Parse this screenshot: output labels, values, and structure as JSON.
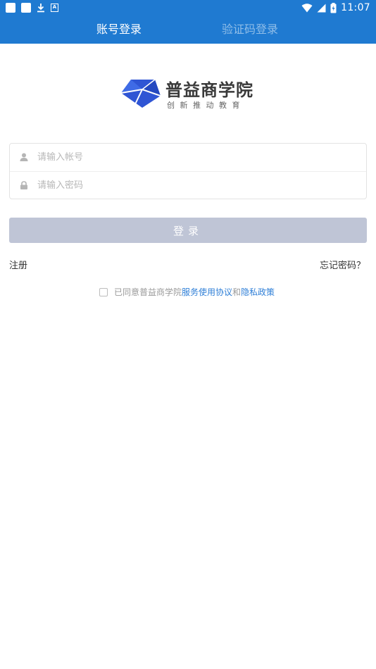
{
  "status_bar": {
    "time": "11:07",
    "icons": [
      "notification-square-icon",
      "notification-square-icon",
      "download-icon",
      "a-box-icon",
      "wifi-icon",
      "signal-icon",
      "battery-icon"
    ]
  },
  "tabs": [
    {
      "label": "账号登录",
      "active": true
    },
    {
      "label": "验证码登录",
      "active": false
    }
  ],
  "logo": {
    "name": "普益商学院",
    "slogan": "创新推动教育"
  },
  "form": {
    "account_placeholder": "请输入帐号",
    "password_placeholder": "请输入密码",
    "login_label": "登录"
  },
  "links": {
    "register": "注册",
    "forgot": "忘记密码？"
  },
  "agreement": {
    "prefix": "已同意普益商学院",
    "service": "服务使用协议",
    "and": "和",
    "privacy": "隐私政策"
  },
  "colors": {
    "primary": "#1f7ad1",
    "tab_inactive": "#8fbde8",
    "button_disabled": "#bfc5d6",
    "link": "#2f7fd7",
    "logo_blue": "#2f55d4"
  }
}
